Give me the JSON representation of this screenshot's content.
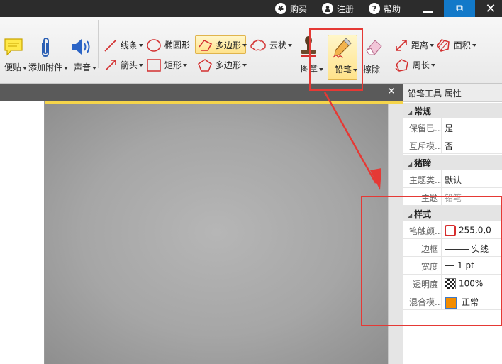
{
  "titlebar": {
    "buy": "购买",
    "buy_glyph": "¥",
    "register": "注册",
    "help": "帮助",
    "help_glyph": "?",
    "restore_glyph": "⧉",
    "close_glyph": "✕",
    "minimize_glyph": "—",
    "bg_color": "#2c2c2c",
    "accent_color": "#1279c9"
  },
  "ribbon": {
    "sticky_note": "便贴",
    "attach_file": "添加附件",
    "sound": "声音",
    "line": "线条",
    "ellipse": "椭圆形",
    "polygon_active": "多边形",
    "cloud": "云状",
    "arrow": "箭头",
    "rectangle": "矩形",
    "polygon": "多边形",
    "stamp": "图章",
    "pencil": "铅笔",
    "eraser": "擦除",
    "distance": "距离",
    "area": "面积",
    "perimeter": "周长"
  },
  "document": {
    "close_glyph": "✕"
  },
  "panel": {
    "title": "铅笔工具 属性",
    "sections": {
      "general": "常规",
      "pencil": "猪蹄",
      "style": "样式"
    },
    "rows": {
      "keep_selected": {
        "name": "保留已...",
        "value": "是"
      },
      "mutual": {
        "name": "互斥模...",
        "value": "否"
      },
      "subject_type": {
        "name": "主题类...",
        "value": "默认"
      },
      "subject": {
        "name": "主题",
        "value": "铅笔"
      },
      "stroke_color": {
        "name": "笔触颜...",
        "value": "255,0,0"
      },
      "border": {
        "name": "边框",
        "value": "实线"
      },
      "width": {
        "name": "宽度",
        "value": "1 pt"
      },
      "opacity": {
        "name": "透明度",
        "value": "100%"
      },
      "blend": {
        "name": "混合模...",
        "value": "正常"
      }
    }
  },
  "colors": {
    "annotation_red": "#e53935",
    "active_button": "#ffe28a",
    "doc_bar": "#5a5a5a",
    "canvas": "#a6a6a6"
  }
}
